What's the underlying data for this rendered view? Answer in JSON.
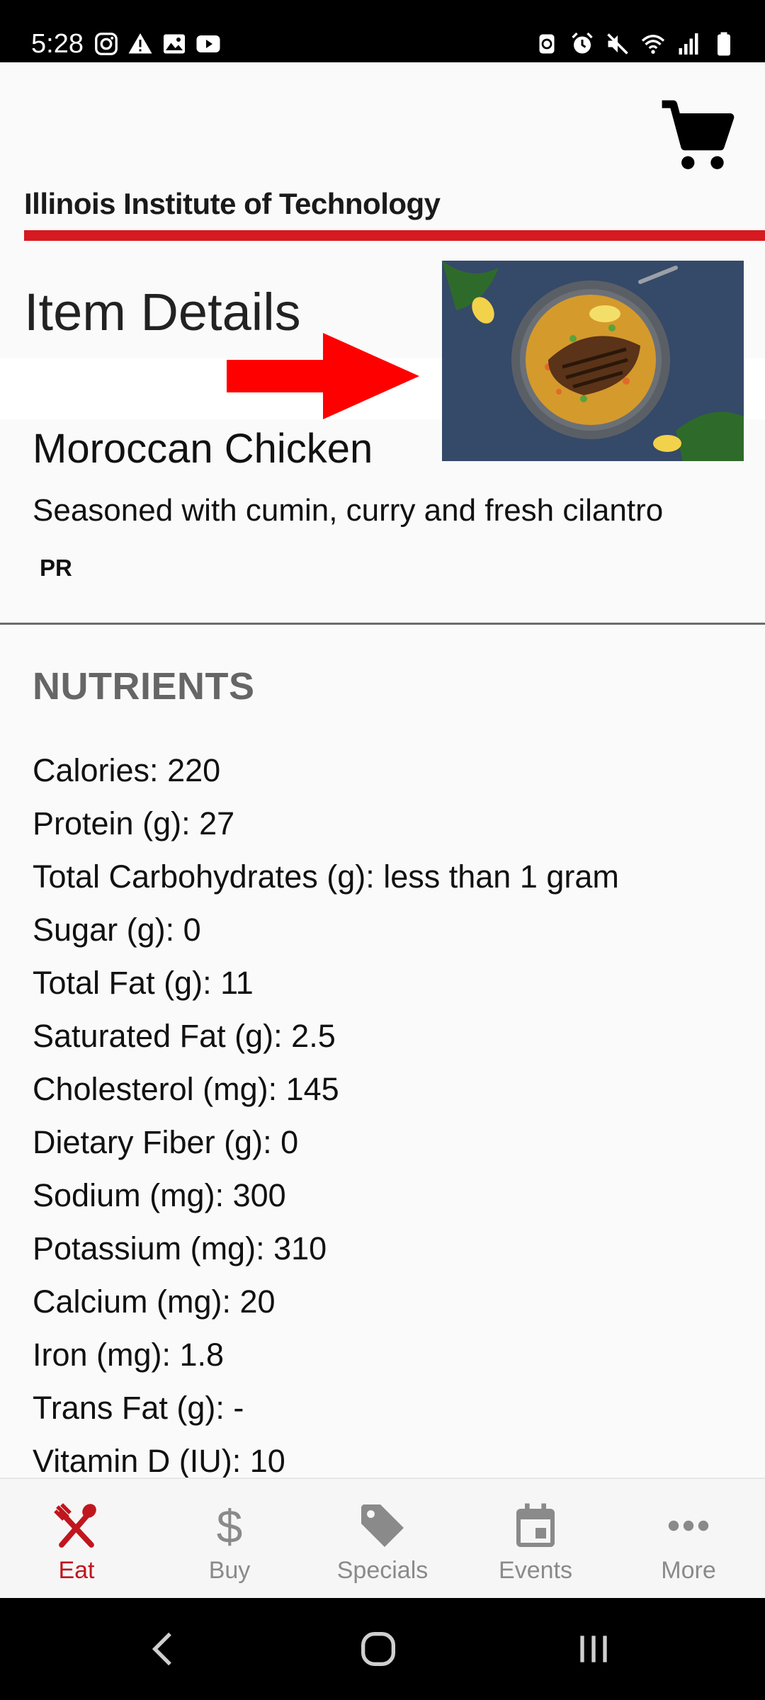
{
  "status_bar": {
    "time": "5:28",
    "left_icons": [
      "instagram-icon",
      "warning-icon",
      "image-icon",
      "youtube-icon"
    ],
    "right_icons": [
      "sync-icon",
      "alarm-icon",
      "mute-icon",
      "wifi-icon",
      "signal-icon",
      "battery-icon"
    ]
  },
  "header": {
    "org_name": "Illinois Institute of Technology",
    "cart_icon": "cart-icon",
    "accent_color": "#d71920"
  },
  "page": {
    "title": "Item Details"
  },
  "item": {
    "name": "Moroccan Chicken",
    "description": "Seasoned with cumin, curry and fresh cilantro",
    "tag": "PR",
    "image_icon": "food-photo"
  },
  "nutrients": {
    "heading": "NUTRIENTS",
    "items": [
      "Calories: 220",
      "Protein (g): 27",
      "Total Carbohydrates (g): less than 1 gram",
      "Sugar (g): 0",
      "Total Fat (g): 11",
      "Saturated Fat (g): 2.5",
      "Cholesterol (mg): 145",
      "Dietary Fiber (g): 0",
      "Sodium (mg): 300",
      "Potassium (mg): 310",
      "Calcium (mg): 20",
      "Iron (mg): 1.8",
      "Trans Fat (g): -",
      "Vitamin D (IU): 10"
    ]
  },
  "bottom_nav": {
    "active_color": "#c0161d",
    "items": [
      {
        "label": "Eat",
        "icon": "fork-knife-icon",
        "active": true
      },
      {
        "label": "Buy",
        "icon": "dollar-icon",
        "active": false
      },
      {
        "label": "Specials",
        "icon": "tag-icon",
        "active": false
      },
      {
        "label": "Events",
        "icon": "calendar-icon",
        "active": false
      },
      {
        "label": "More",
        "icon": "more-icon",
        "active": false
      }
    ]
  }
}
